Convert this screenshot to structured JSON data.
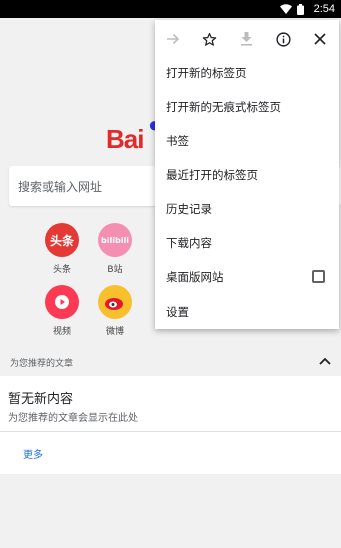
{
  "status_bar": {
    "time": "2:54"
  },
  "search": {
    "placeholder": "搜索或输入网址"
  },
  "logo": {
    "text": "Bai"
  },
  "shortcuts": [
    {
      "label": "头条",
      "icon_text": "头条",
      "color": "#e53935"
    },
    {
      "label": "B站",
      "icon_text": "bilibili",
      "color": "#f48fb1"
    },
    {
      "label": "视频",
      "icon_text": "",
      "color": "#fc3a53"
    },
    {
      "label": "微博",
      "icon_text": "",
      "color": "#f9c02e"
    }
  ],
  "recommended": {
    "header": "为您推荐的文章",
    "title": "暂无新内容",
    "subtitle": "为您推荐的文章会显示在此处",
    "more": "更多"
  },
  "menu": {
    "icons": [
      "forward-icon",
      "star-icon",
      "download-icon",
      "info-icon",
      "close-icon"
    ],
    "items": [
      "打开新的标签页",
      "打开新的无痕式标签页",
      "书签",
      "最近打开的标签页",
      "历史记录",
      "下载内容",
      "桌面版网站",
      "设置"
    ]
  },
  "colors": {
    "accent": "#1a73e8",
    "baidu_red": "#e12a2a",
    "baidu_blue": "#2932e1"
  }
}
